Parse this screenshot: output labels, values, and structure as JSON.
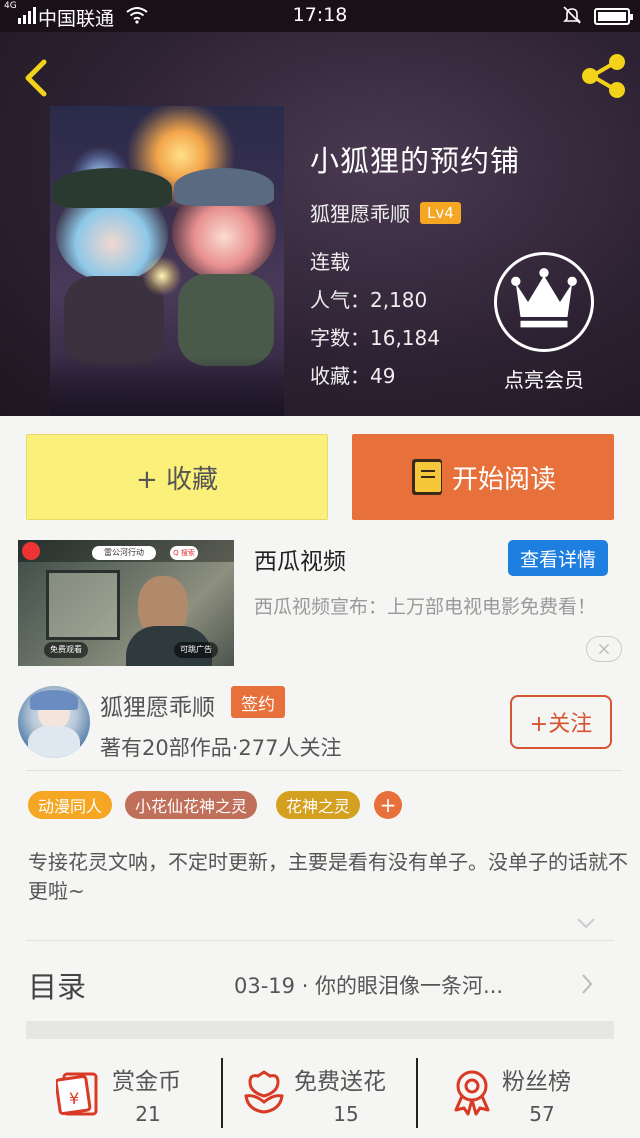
{
  "status_bar": {
    "network": "4G",
    "carrier": "中国联通",
    "time": "17:18"
  },
  "book": {
    "title": "小狐狸的预约铺",
    "author": "狐狸愿乖顺",
    "level": "Lv4",
    "status": "连载",
    "stats": [
      {
        "label": "人气：",
        "value": "2,180"
      },
      {
        "label": "字数：",
        "value": "16,184"
      },
      {
        "label": "收藏：",
        "value": "49"
      }
    ],
    "vip_label": "点亮会员"
  },
  "actions": {
    "collect_label": "+ 收藏",
    "read_label": "开始阅读"
  },
  "ad": {
    "title": "西瓜视频",
    "button": "查看详情",
    "description": "西瓜视频宣布：上万部电视电影免费看！",
    "thumb_title": "雷公河行动",
    "thumb_search": "Q 搜索",
    "thumb_caption_left": "免费观看",
    "thumb_caption_right": "可跳广告"
  },
  "author": {
    "name": "狐狸愿乖顺",
    "badge": "签约",
    "meta": "著有20部作品·277人关注",
    "follow": "+关注"
  },
  "tags": [
    {
      "label": "动漫同人",
      "color": "#f5a623"
    },
    {
      "label": "小花仙花神之灵",
      "color": "#c0705a"
    },
    {
      "label": "花神之灵",
      "color": "#d4a020"
    }
  ],
  "tag_add": "+",
  "intro": "专接花灵文呐，不定时更新，主要是看有没有单子。没单子的话就不更啦~",
  "toc": {
    "label": "目录",
    "latest": "03-19 · 你的眼泪像一条河..."
  },
  "bottom": [
    {
      "label": "赏金币",
      "value": "21",
      "icon": "red-envelope-icon"
    },
    {
      "label": "免费送花",
      "value": "15",
      "icon": "flower-icon"
    },
    {
      "label": "粉丝榜",
      "value": "57",
      "icon": "medal-icon"
    }
  ],
  "colors": {
    "accent": "#e8703a",
    "collect_bg": "#fbf07a",
    "ad_button": "#1e7fe0",
    "icon_red": "#d93a25"
  }
}
